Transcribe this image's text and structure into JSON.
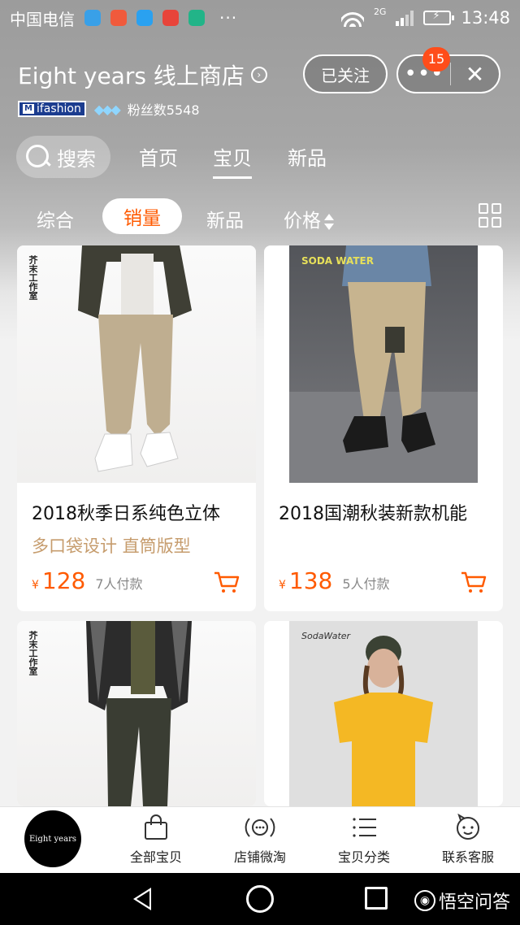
{
  "status_bar": {
    "carrier": "中国电信",
    "network": "2G",
    "time": "13:48",
    "dots": "···"
  },
  "store": {
    "name": "Eight years 线上商店",
    "name_arrow_icon": "chevron-right-circle-icon",
    "badge_label": "ifashion",
    "fans_label": "粉丝数5548",
    "follow_label": "已关注",
    "notification_count": "15",
    "more_icon": "more-dots-icon",
    "close_icon": "close-icon"
  },
  "nav": {
    "search_label": "搜索",
    "tabs": [
      "首页",
      "宝贝",
      "新品"
    ],
    "active_tab": "宝贝"
  },
  "sort": {
    "tabs": [
      "综合",
      "销量",
      "新品",
      "价格"
    ],
    "active": "销量",
    "accent_color": "#ff5a00"
  },
  "products": [
    {
      "brand_mark": "芥末工作室",
      "title": "2018秋季日系纯色立体",
      "subtitle": "多口袋设计 直筒版型",
      "currency": "¥",
      "price": "128",
      "sold": "7人付款"
    },
    {
      "brand_mark": "SODA WATER",
      "title": "2018国潮秋装新款机能",
      "subtitle": "",
      "currency": "¥",
      "price": "138",
      "sold": "5人付款"
    },
    {
      "brand_mark": "芥末工作室",
      "title": "",
      "subtitle": "",
      "currency": "",
      "price": "",
      "sold": ""
    },
    {
      "brand_mark": "SodaWater",
      "title": "",
      "subtitle": "",
      "currency": "",
      "price": "",
      "sold": ""
    }
  ],
  "bottom_bar": {
    "shop_logo_text": "Eight years",
    "items": [
      {
        "label": "全部宝贝",
        "icon": "shopping-bag-icon"
      },
      {
        "label": "店铺微淘",
        "icon": "broadcast-icon"
      },
      {
        "label": "宝贝分类",
        "icon": "list-icon"
      },
      {
        "label": "联系客服",
        "icon": "customer-service-icon"
      }
    ]
  },
  "system_nav": {
    "watermark": "悟空问答"
  }
}
